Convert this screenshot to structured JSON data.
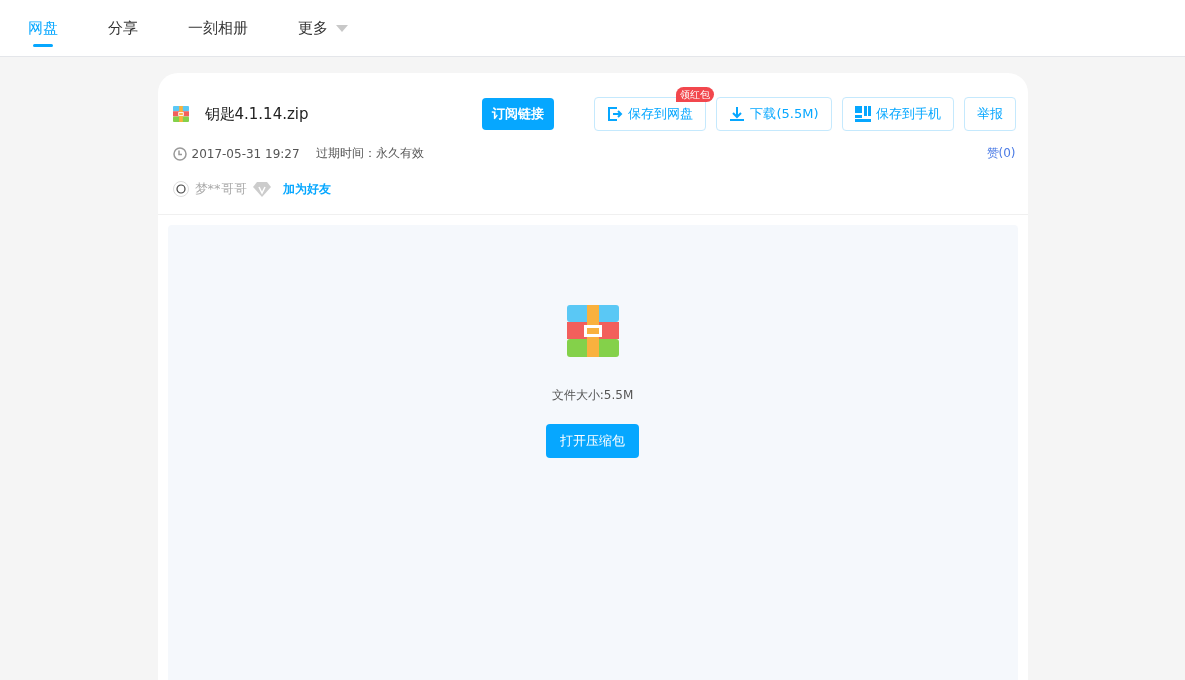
{
  "nav": {
    "tabs": [
      {
        "label": "网盘",
        "selected": true
      },
      {
        "label": "分享",
        "selected": false
      },
      {
        "label": "一刻相册",
        "selected": false
      },
      {
        "label": "更多",
        "selected": false,
        "has_menu": true
      }
    ]
  },
  "file": {
    "name": "钥匙4.1.14.zip",
    "subscribe": "订阅链接",
    "actions": [
      {
        "kind": "save",
        "label": "保存到网盘",
        "badge": "领红包"
      },
      {
        "kind": "download",
        "label": "下载(5.5M)"
      },
      {
        "kind": "phone",
        "label": "保存到手机"
      },
      {
        "kind": "report",
        "label": "举报"
      }
    ],
    "time": "2017-05-31 19:27",
    "expiry": "过期时间：永久有效",
    "likes": "赞(0)",
    "user": "梦**哥哥",
    "add_friend": "加为好友"
  },
  "preview": {
    "size": "文件大小:5.5M",
    "open": "打开压缩包"
  }
}
